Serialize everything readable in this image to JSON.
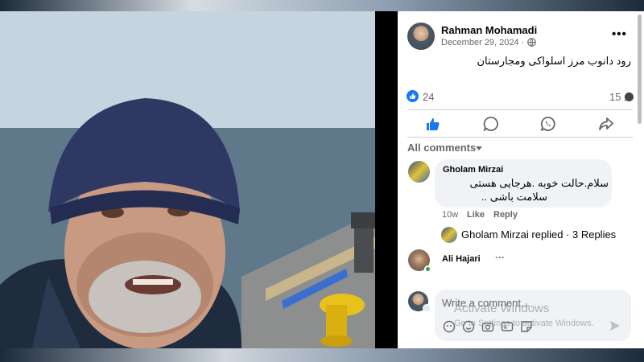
{
  "post": {
    "author": "Rahman Mohamadi",
    "date": "December 29, 2024 ·",
    "text": "رود دانوب مرز اسلواکی ومجارستان",
    "likes": "24",
    "comments": "15"
  },
  "actions": [
    "like-icon",
    "comment-icon",
    "whatsapp-icon",
    "share-icon"
  ],
  "comments": {
    "filter_label": "All comments",
    "items": [
      {
        "name": "Gholam Mirzai",
        "lines": [
          "سلام.حالت خوبه .هرجایی هستی",
          "سلامت باشی .."
        ],
        "time": "10w",
        "like": "Like",
        "reply": "Reply",
        "replies_text": "Gholam Mirzai replied · 3 Replies"
      },
      {
        "name": "Ali Hajari",
        "more": "···"
      }
    ]
  },
  "composer": {
    "placeholder": "Write a comment..."
  },
  "watermark": {
    "line1": "Activate Windows",
    "line2": "Go to Settings to activate Windows."
  },
  "colors": {
    "brand": "#1877f2",
    "online": "#31a24c",
    "muted": "#65676b"
  }
}
